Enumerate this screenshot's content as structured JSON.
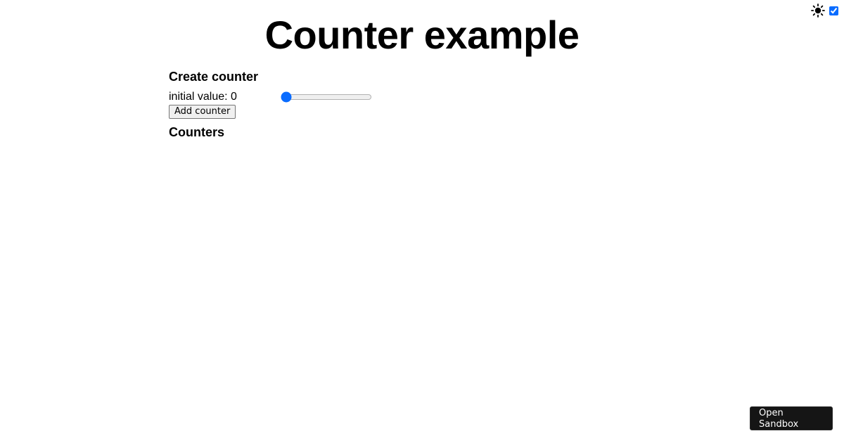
{
  "theme": {
    "icon": "sun-icon",
    "dark_mode_checked": true
  },
  "header": {
    "title": "Counter example"
  },
  "create": {
    "heading": "Create counter",
    "initial_label": "initial value: 0",
    "slider_value": 0,
    "add_button_label": "Add counter"
  },
  "counters": {
    "heading": "Counters",
    "items": []
  },
  "sandbox": {
    "label": "Open Sandbox"
  }
}
